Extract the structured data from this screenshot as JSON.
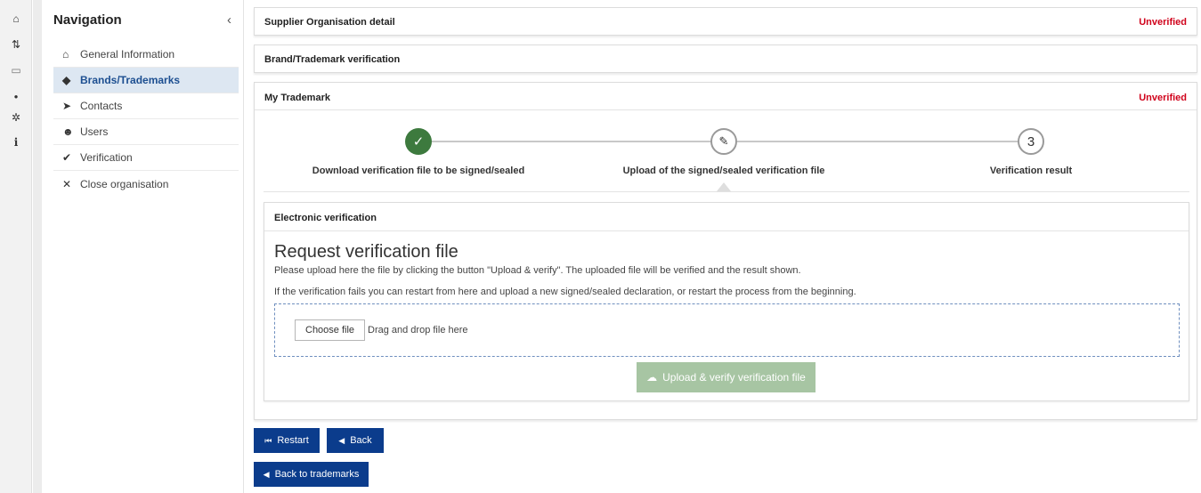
{
  "rail": {
    "items": [
      {
        "icon": "home-icon",
        "glyph": "⌂"
      },
      {
        "icon": "sort-icon",
        "glyph": "⇅"
      },
      {
        "icon": "folder-icon",
        "glyph": "▭"
      },
      {
        "icon": "dot-icon",
        "glyph": "●"
      },
      {
        "icon": "gear-icon",
        "glyph": "✲"
      },
      {
        "icon": "info-icon",
        "glyph": "i"
      }
    ]
  },
  "nav": {
    "title": "Navigation",
    "collapse_glyph": "‹",
    "items": [
      {
        "label": "General Information",
        "icon": "home-icon",
        "glyph": "⌂"
      },
      {
        "label": "Brands/Trademarks",
        "icon": "tag-icon",
        "glyph": "◆",
        "active": true
      },
      {
        "label": "Contacts",
        "icon": "send-icon",
        "glyph": "➤"
      },
      {
        "label": "Users",
        "icon": "users-icon",
        "glyph": "☻"
      },
      {
        "label": "Verification",
        "icon": "check-circle-icon",
        "glyph": "✔"
      },
      {
        "label": "Close organisation",
        "icon": "close-icon",
        "glyph": "✕"
      }
    ]
  },
  "cards": {
    "supplier": {
      "title": "Supplier Organisation detail",
      "status": "Unverified"
    },
    "brand": {
      "title": "Brand/Trademark verification"
    },
    "trademark": {
      "title": "My Trademark",
      "status": "Unverified"
    }
  },
  "stepper": {
    "steps": [
      {
        "label": "Download verification file to be signed/sealed",
        "state": "done",
        "glyph": "✓"
      },
      {
        "label": "Upload of the signed/sealed verification file",
        "state": "current",
        "glyph": "✎"
      },
      {
        "label": "Verification result",
        "state": "todo",
        "glyph": "3"
      }
    ]
  },
  "electronic": {
    "heading": "Electronic verification",
    "title": "Request verification file",
    "p1": "Please upload here the file by clicking the button \"Upload & verify\". The uploaded file will be verified and the result shown.",
    "p2": "If the verification fails you can restart from here and upload a new signed/sealed declaration, or restart the process from the beginning.",
    "choose_file": "Choose file",
    "drop_text": "Drag and drop file here",
    "upload_label": "Upload & verify verification file"
  },
  "actions": {
    "restart": "Restart",
    "back": "Back",
    "back_to_trademarks": "Back to trademarks"
  },
  "colors": {
    "unverified": "#d0021b",
    "primary": "#0b3c8c",
    "success": "#3d7a3e",
    "upload_disabled": "#a7c5a3"
  }
}
